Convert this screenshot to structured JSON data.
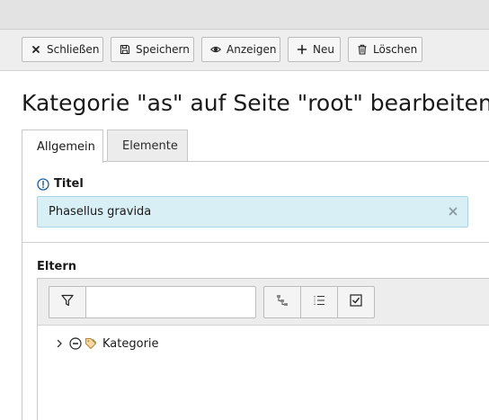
{
  "toolbar": {
    "close_label": "Schließen",
    "save_label": "Speichern",
    "view_label": "Anzeigen",
    "new_label": "Neu",
    "delete_label": "Löschen"
  },
  "page": {
    "title": "Kategorie \"as\" auf Seite \"root\" bearbeiten"
  },
  "tabs": [
    {
      "label": "Allgemein",
      "active": true
    },
    {
      "label": "Elemente",
      "active": false
    }
  ],
  "form": {
    "title_field": {
      "label": "Titel",
      "value": "Phasellus gravida"
    },
    "parent_field": {
      "label": "Eltern",
      "filter_value": ""
    }
  },
  "tree": {
    "items": [
      {
        "label": "Kategorie",
        "icon": "category-tag-icon",
        "expanded": false
      }
    ]
  },
  "colors": {
    "input_highlight": "#d9eff6",
    "input_border": "#a9d6e4",
    "info_icon": "#1a5fa8"
  }
}
